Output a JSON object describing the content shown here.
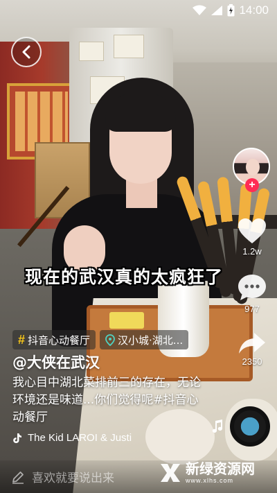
{
  "status_bar": {
    "time": "14:00"
  },
  "caption": "现在的武汉真的太疯狂了",
  "rail": {
    "like_count": "1.2w",
    "comment_count": "977",
    "share_count": "2350",
    "follow_symbol": "+"
  },
  "tags": [
    {
      "icon": "hashtag-icon",
      "symbol": "#",
      "label": "抖音心动餐厅"
    },
    {
      "icon": "location-pin-icon",
      "label": "汉小城·湖北..."
    }
  ],
  "author": "@大侠在武汉",
  "description": "我心目中湖北菜排前三的存在，无论环境还是味道...你们觉得呢#抖音心动餐厅",
  "music": "The Kid LAROI & Justi",
  "comment_placeholder": "喜欢就要说出来",
  "watermark": {
    "title": "新绿资源网",
    "url": "www.xlhs.com"
  },
  "colors": {
    "follow": "#ff2c55",
    "hashtag": "#f5c518"
  }
}
